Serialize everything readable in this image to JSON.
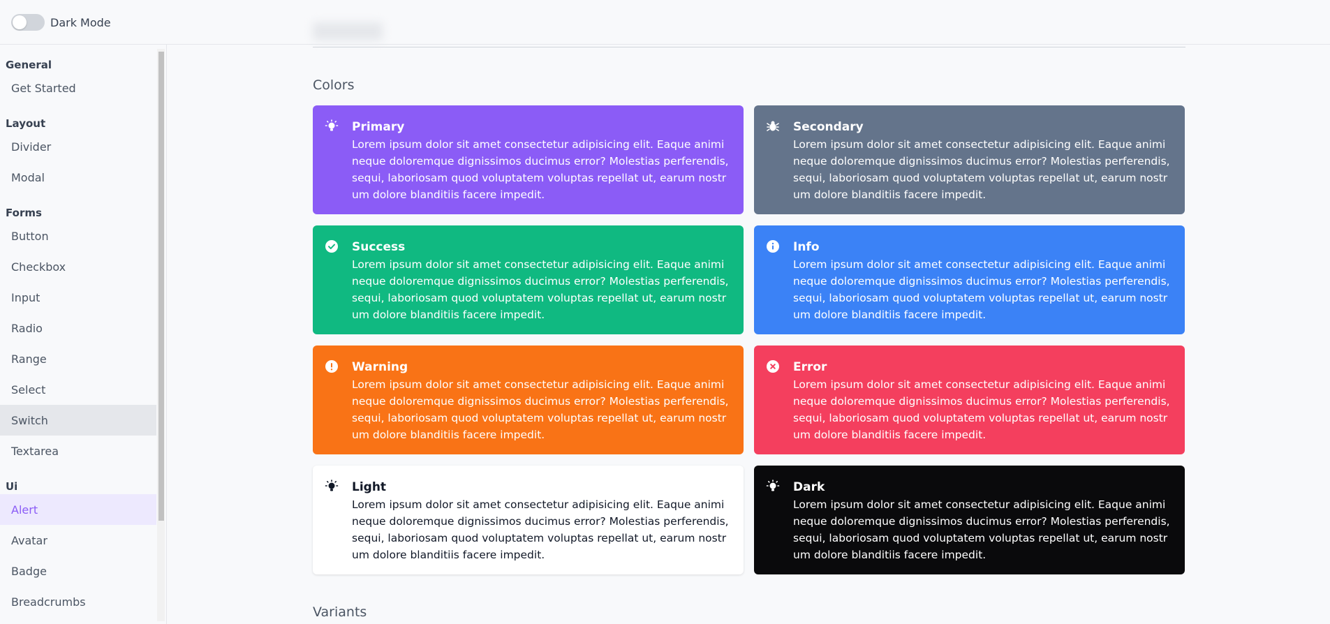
{
  "topbar": {
    "dark_mode_label": "Dark Mode"
  },
  "sidebar": {
    "sections": [
      {
        "title": "General",
        "items": [
          "Get Started"
        ]
      },
      {
        "title": "Layout",
        "items": [
          "Divider",
          "Modal"
        ]
      },
      {
        "title": "Forms",
        "items": [
          "Button",
          "Checkbox",
          "Input",
          "Radio",
          "Range",
          "Select",
          "Switch",
          "Textarea"
        ]
      },
      {
        "title": "Ui",
        "items": [
          "Alert",
          "Avatar",
          "Badge",
          "Breadcrumbs"
        ]
      }
    ],
    "hovered_item": "Switch",
    "active_item": "Alert"
  },
  "main": {
    "colors_heading": "Colors",
    "variants_heading": "Variants",
    "lorem": "Lorem ipsum dolor sit amet consectetur adipisicing elit. Eaque animi neque doloremque dignissimos ducimus error? Molestias perferendis, sequi, laboriosam quod voluptatem voluptas repellat ut, earum nostrum dolore blanditiis facere impedit.",
    "alerts": [
      {
        "title": "Primary",
        "color": "#8b5cf6",
        "icon": "lightbulb-icon"
      },
      {
        "title": "Secondary",
        "color": "#64748b",
        "icon": "bug-icon"
      },
      {
        "title": "Success",
        "color": "#10b981",
        "icon": "check-circle-icon"
      },
      {
        "title": "Info",
        "color": "#3b82f6",
        "icon": "info-circle-icon"
      },
      {
        "title": "Warning",
        "color": "#f97316",
        "icon": "exclamation-circle-icon"
      },
      {
        "title": "Error",
        "color": "#f43f5e",
        "icon": "x-circle-icon"
      },
      {
        "title": "Light",
        "color": "#ffffff",
        "icon": "lightbulb-icon"
      },
      {
        "title": "Dark",
        "color": "#0a0a0c",
        "icon": "lightbulb-icon"
      }
    ]
  }
}
